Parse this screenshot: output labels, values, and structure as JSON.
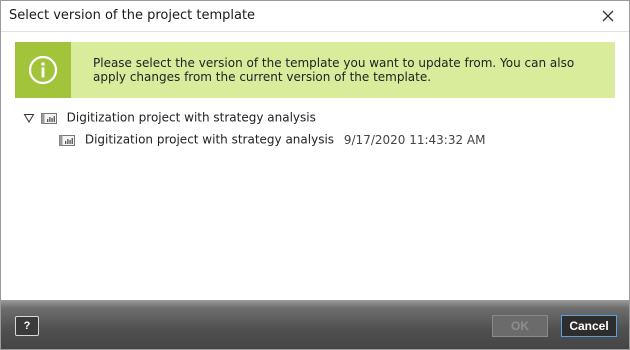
{
  "window": {
    "title": "Select version of the project template"
  },
  "banner": {
    "icon": "info-icon",
    "text": "Please select the version of the template you want to update from. You can also apply changes from the current version of the template.",
    "colors": {
      "background": "#d8ec9c",
      "icon_box": "#a2c43a"
    }
  },
  "tree": {
    "root": {
      "expanded": true,
      "label": "Digitization project with strategy analysis",
      "icon": "project-template-icon",
      "children": [
        {
          "label": "Digitization project with strategy analysis",
          "date": "9/17/2020 11:43:32 AM",
          "icon": "project-template-icon"
        }
      ]
    }
  },
  "footer": {
    "help_label": "?",
    "ok_label": "OK",
    "ok_enabled": false,
    "cancel_label": "Cancel"
  }
}
